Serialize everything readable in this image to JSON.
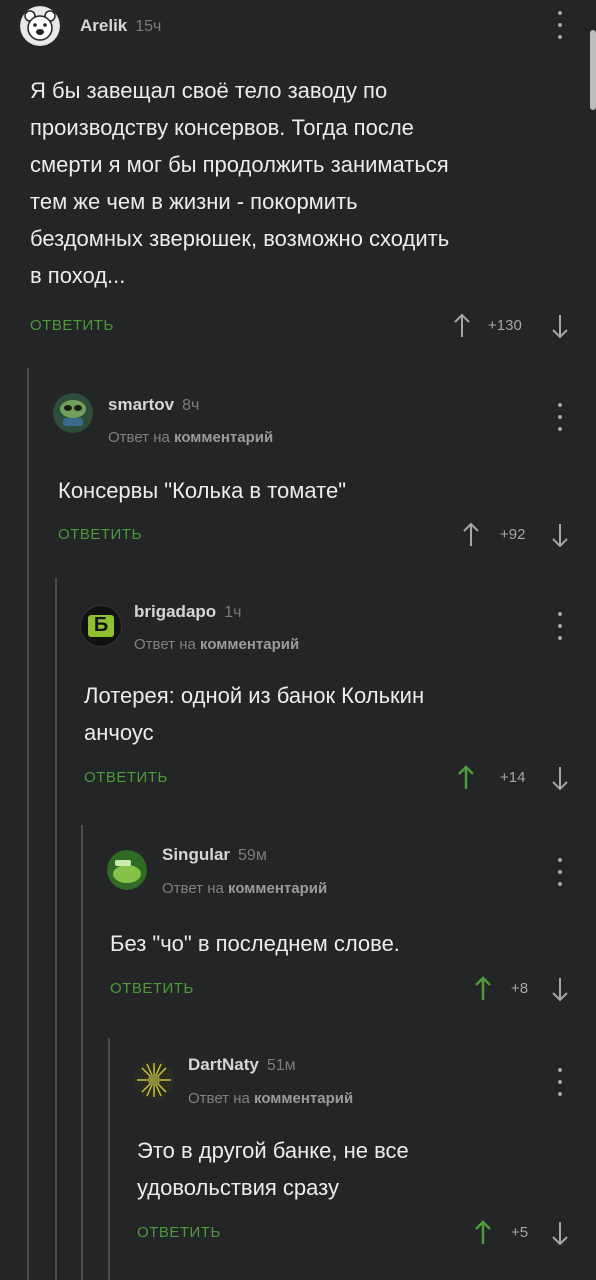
{
  "comments": [
    {
      "username": "Arelik",
      "time": "15ч",
      "reply_prefix": "",
      "reply_target": "",
      "lines": [
        "Я бы завещал своё тело заводу по",
        "производству консервов. Тогда после",
        "смерти я мог бы продолжить заниматься",
        "тем же чем в жизни - покормить",
        "бездомных зверюшек, возможно сходить",
        "в поход..."
      ],
      "reply_label": "ОТВЕТИТЬ",
      "votes": "+130",
      "vote_up_active": false
    },
    {
      "username": "smartov",
      "time": "8ч",
      "reply_prefix": "Ответ на",
      "reply_target": "комментарий",
      "lines": [
        "Консервы \"Колька в томате\""
      ],
      "reply_label": "ОТВЕТИТЬ",
      "votes": "+92",
      "vote_up_active": false
    },
    {
      "username": "brigadapo",
      "time": "1ч",
      "reply_prefix": "Ответ на",
      "reply_target": "комментарий",
      "lines": [
        "Лотерея: одной из банок Колькин",
        "анчоус"
      ],
      "reply_label": "ОТВЕТИТЬ",
      "votes": "+14",
      "vote_up_active": true
    },
    {
      "username": "Singular",
      "time": "59м",
      "reply_prefix": "Ответ на",
      "reply_target": "комментарий",
      "lines": [
        "Без \"чо\" в последнем слове."
      ],
      "reply_label": "ОТВЕТИТЬ",
      "votes": "+8",
      "vote_up_active": true
    },
    {
      "username": "DartNaty",
      "time": "51м",
      "reply_prefix": "Ответ на",
      "reply_target": "комментарий",
      "lines": [
        "Это в другой банке, не все",
        "удовольствия сразу"
      ],
      "reply_label": "ОТВЕТИТЬ",
      "votes": "+5",
      "vote_up_active": true
    }
  ],
  "avatars": {
    "brigadapo_glyph": "Б"
  },
  "colors": {
    "background": "#242527",
    "accent_green": "#4c9a3a",
    "vote_active": "#4c9a3a"
  }
}
